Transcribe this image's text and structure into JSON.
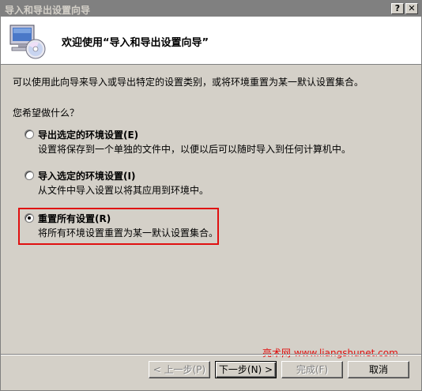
{
  "window": {
    "title": "导入和导出设置向导",
    "help_glyph": "?",
    "close_glyph": "✕"
  },
  "header": {
    "title": "欢迎使用“导入和导出设置向导”",
    "icon": "computer-cd-icon"
  },
  "intro_text": "可以使用此向导来导入或导出特定的设置类别，或将环境重置为某一默认设置集合。",
  "question": "您希望做什么？",
  "options": [
    {
      "label": "导出选定的环境设置(E)",
      "description": "设置将保存到一个单独的文件中，以便以后可以随时导入到任何计算机中。",
      "checked": false
    },
    {
      "label": "导入选定的环境设置(I)",
      "description": "从文件中导入设置以将其应用到环境中。",
      "checked": false
    },
    {
      "label": "重置所有设置(R)",
      "description": "将所有环境设置重置为某一默认设置集合。",
      "checked": true
    }
  ],
  "highlight_color": "#e01010",
  "watermark": "亮术网 www.liangshunet.com",
  "buttons": {
    "back": "< 上一步(P)",
    "next": "下一步(N) >",
    "finish": "完成(F)",
    "cancel": "取消"
  }
}
